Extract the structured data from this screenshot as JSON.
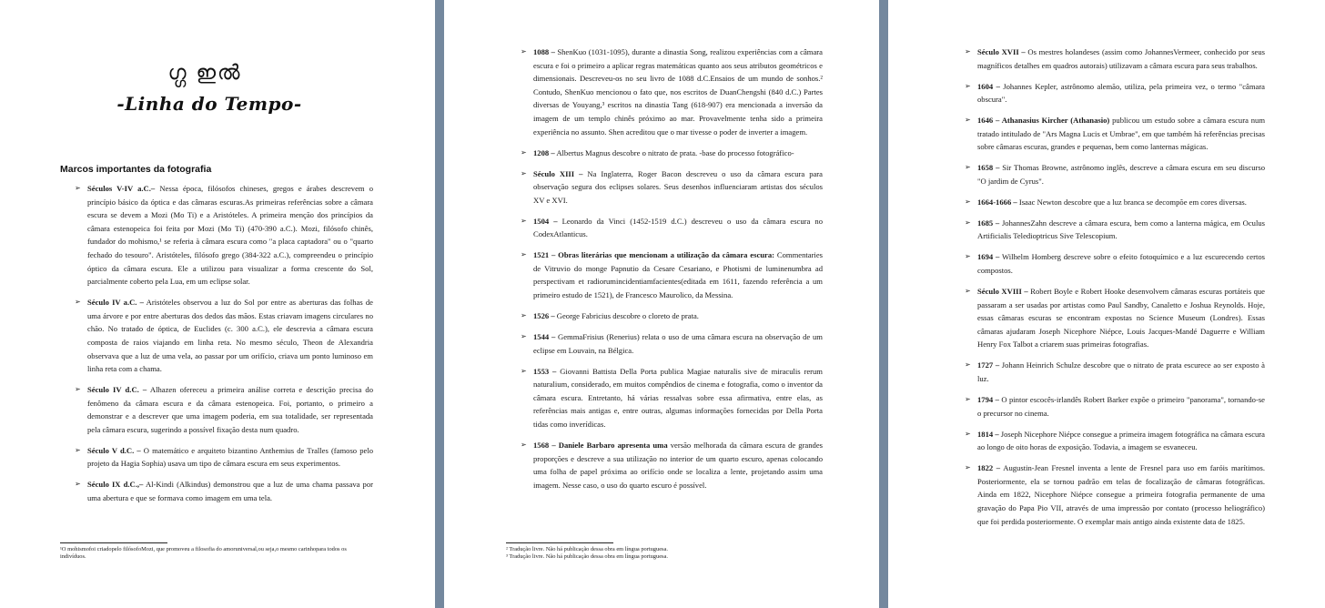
{
  "page1": {
    "ornament": "ഗ്ഗ ഇൽ",
    "title": "-Linha do Tempo-",
    "section_heading": "Marcos importantes da fotografia",
    "items": [
      {
        "head": "Séculos V-IV a.C.–",
        "text": " Nessa época, filósofos chineses, gregos e árabes descrevem o princípio básico da óptica e das câmaras escuras.As primeiras referências sobre a câmara escura se devem a Mozi (Mo Ti) e a Aristóteles. A primeira menção dos princípios da câmara estenopeica foi feita por Mozi (Mo Ti) (470-390 a.C.). Mozi, filósofo chinês, fundador do mohismo,¹ se referia à câmara escura como \"a placa captadora\" ou o \"quarto fechado do tesouro\". Aristóteles, filósofo grego (384-322 a.C.), compreendeu o princípio óptico da câmara escura. Ele a utilizou para visualizar a forma crescente do Sol, parcialmente coberto pela Lua, em um eclipse solar."
      },
      {
        "head": "Século IV a.C. –",
        "text": " Aristóteles observou a luz do Sol por entre as aberturas das folhas de uma árvore e por entre aberturas dos dedos das mãos. Estas criavam imagens circulares no chão. No tratado de óptica, de Euclides (c. 300 a.C.), ele descrevia a câmara escura composta de raios viajando em linha reta. No mesmo século, Theon de Alexandria observava que a luz de uma vela, ao passar por um orifício, criava um ponto luminoso em linha reta com a chama."
      },
      {
        "head": "Século IV d.C. –",
        "text": " Alhazen ofereceu a primeira análise correta e descrição precisa do fenômeno da câmara escura e da câmara estenopeica. Foi, portanto, o primeiro a demonstrar e a descrever que uma imagem poderia, em sua totalidade, ser representada pela câmara escura, sugerindo a possível fixação desta num quadro."
      },
      {
        "head": "Século V d.C. –",
        "text": " O matemático e arquiteto bizantino Anthemius de Tralles (famoso pelo projeto da Hagia Sophia) usava um tipo de câmara escura em seus experimentos."
      },
      {
        "head": "Século IX d.C.,–",
        "text": " Al-Kindi (Alkindus) demonstrou que a luz de uma chama passava por uma abertura e que se formava como imagem em uma tela."
      }
    ],
    "footnotes": [
      "¹O mohismofoi criadopelo filósofoMozi, que promoveu a filosofia do amoruniversal,ou seja,o mesmo carinhopara todos os indivíduos."
    ]
  },
  "page2": {
    "items": [
      {
        "head": "1088 –",
        "text": " ShenKuo (1031-1095), durante a dinastia Song, realizou experiências com a câmara escura e foi o primeiro a aplicar regras matemáticas quanto aos seus atributos geométricos e dimensionais. Descreveu-os no seu livro de 1088 d.C.Ensaios de um mundo de sonhos.² Contudo, ShenKuo mencionou o fato que, nos escritos de DuanChengshi (840 d.C.) Partes diversas de Youyang,³ escritos na dinastia Tang (618-907) era mencionada a inversão da imagem de um templo chinês próximo ao mar. Provavelmente tenha sido a primeira experiência no assunto. Shen acreditou que o mar tivesse o poder de inverter a imagem."
      },
      {
        "head": "1208 –",
        "text": " Albertus Magnus descobre o nitrato de prata. -base do processo fotográfico-"
      },
      {
        "head": "Século XIII –",
        "text": " Na Inglaterra, Roger Bacon descreveu o uso da câmara escura para observação segura dos eclipses solares. Seus desenhos influenciaram artistas dos séculos XV e XVI."
      },
      {
        "head": "1504 –",
        "text": " Leonardo da Vinci (1452-1519 d.C.) descreveu o uso da câmara escura no CodexAtlanticus."
      },
      {
        "head": "1521 – Obras literárias que mencionam a utilização da câmara escura:",
        "text": " Commentaries de Vitruvio do monge Papnutio da Cesare Cesariano, e Photismi de luminenumbra ad perspectivam et radiorumincidentiamfacientes(editada em 1611, fazendo referência a um primeiro estudo de 1521), de Francesco Maurolico, da Messina."
      },
      {
        "head": "1526 –",
        "text": " George Fabricius descobre o cloreto de prata."
      },
      {
        "head": "1544 –",
        "text": " GemmaFrisius (Renerius) relata o uso de uma câmara escura na observação de um eclipse em Louvain, na Bélgica."
      },
      {
        "head": "1553 –",
        "text": " Giovanni Battista Della Porta publica Magiae naturalis sive de miraculis rerum naturalium, considerado, em muitos compêndios de cinema e fotografia, como o inventor da câmara escura. Entretanto, há várias ressalvas sobre essa afirmativa, entre elas, as referências mais antigas e, entre outras, algumas informações fornecidas por Della Porta tidas como inverídicas."
      },
      {
        "head": "1568 – Daniele Barbaro apresenta uma",
        "text": " versão melhorada da câmara escura de grandes proporções e descreve a sua utilização no interior de um quarto escuro, apenas colocando uma folha de papel próxima ao orifício onde se localiza a lente, projetando assim uma imagem. Nesse caso, o uso do quarto escuro é possível."
      }
    ],
    "footnotes": [
      "² Tradução livre. Não há publicação dessa obra em língua portuguesa.",
      "³ Tradução livre. Não há publicação dessa obra em língua portuguesa."
    ]
  },
  "page3": {
    "items": [
      {
        "head": "Século XVII –",
        "text": " Os mestres holandeses (assim como JohannesVermeer, conhecido por seus magníficos detalhes em quadros autorais) utilizavam a câmara escura para seus trabalhos."
      },
      {
        "head": "1604 –",
        "text": " Johannes Kepler, astrônomo alemão, utiliza, pela primeira vez, o termo \"câmara obscura\"."
      },
      {
        "head": "1646 – Athanasius Kircher (Athanasio)",
        "text": " publicou um estudo sobre a câmara escura num tratado intitulado de \"Ars Magna Lucis et Umbrae\", em que também há referências precisas sobre câmaras escuras, grandes e pequenas, bem como lanternas mágicas."
      },
      {
        "head": "1658 –",
        "text": " Sir Thomas Browne, astrônomo inglês, descreve a câmara escura em seu discurso \"O jardim de Cyrus\"."
      },
      {
        "head": "1664-1666 –",
        "text": " Isaac Newton descobre que a luz branca se decompõe em cores diversas."
      },
      {
        "head": "1685 –",
        "text": " JohannesZahn descreve a câmara escura, bem como a lanterna mágica, em Oculus Artificialis Teledioptricus Sive Telescopium."
      },
      {
        "head": "1694 –",
        "text": " Wilhelm Homberg descreve sobre o efeito fotoquímico e a luz escurecendo certos compostos."
      },
      {
        "head": "Século XVIII –",
        "text": " Robert Boyle e Robert Hooke desenvolvem câmaras escuras portáteis que passaram a ser usadas por artistas como Paul Sandby, Canaletto e Joshua Reynolds. Hoje, essas câmaras escuras se encontram expostas no Science Museum (Londres). Essas câmaras ajudaram Joseph Nicephore Niépce, Louis Jacques-Mandé Daguerre e William Henry Fox Talbot a criarem suas primeiras fotografias."
      },
      {
        "head": "1727 –",
        "text": " Johann Heinrich Schulze descobre que o nitrato de prata escurece ao ser exposto à luz."
      },
      {
        "head": "1794 –",
        "text": " O pintor escocês-irlandês Robert Barker expõe o primeiro \"panorama\", tornando-se o precursor no cinema."
      },
      {
        "head": "1814 –",
        "text": " Joseph Nicephore Niépce consegue a primeira imagem fotográfica na câmara escura ao longo de oito horas de exposição. Todavia, a imagem se esvaneceu."
      },
      {
        "head": "1822 –",
        "text": " Augustin-Jean Fresnel inventa a lente de Fresnel para uso em faróis marítimos. Posteriormente, ela se tornou padrão em telas de focalização de câmaras fotográficas. Ainda em 1822, Nicephore Niépce consegue a primeira fotografia permanente de uma gravação do Papa Pio VII, através de uma impressão por contato (processo heliográfico) que foi perdida posteriormente. O exemplar mais antigo ainda existente data de 1825."
      }
    ]
  },
  "bullet_glyph": "➢"
}
